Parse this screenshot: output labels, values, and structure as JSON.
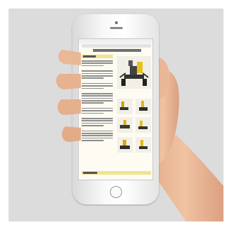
{
  "scene": {
    "description_icons": [
      "phone-icon",
      "hand-icon"
    ],
    "colors": {
      "background": "#dcdcdc",
      "phone_body": "#f4f4f4",
      "skin": "#e9b896",
      "screen": "#fdfbf2",
      "section_header": "#f0e48e"
    }
  }
}
